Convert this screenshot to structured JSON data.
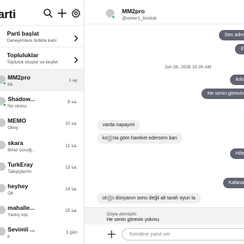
{
  "sidebar": {
    "title": "arti",
    "actions": [
      {
        "title": "Parti başlat",
        "subtitle": "Deneyimlere birlikte katıl"
      },
      {
        "title": "Topluluklar",
        "subtitle": "Topluluk oluştur ve keşfet"
      }
    ],
    "conversations": [
      {
        "name": "MM2pro",
        "last": "bb",
        "time": "1 ay",
        "online": true,
        "active": true
      },
      {
        "name": "Shadow...",
        "last": "No stress",
        "time": "9 sa.",
        "online": true,
        "active": false
      },
      {
        "name": "MEMO",
        "last": "Okey",
        "time": "10 sa.",
        "online": false,
        "active": false
      },
      {
        "name": "skara",
        "last": "Biraz çocuğ...",
        "time": "11 sa.",
        "online": false,
        "active": false
      },
      {
        "name": "TurkEray",
        "last": "Takipçilerim",
        "time": "13 sa.",
        "online": false,
        "active": false
      },
      {
        "name": "heyhey",
        "last": "Ok",
        "time": "14 sa.",
        "online": false,
        "active": false
      },
      {
        "name": "mahalle...",
        "last": "Yanlış kişi",
        "time": "15 sa.",
        "online": false,
        "active": false
      },
      {
        "name": "Sevimli ...",
        "last": "k",
        "time": "1 gün",
        "online": false,
        "active": false
      }
    ]
  },
  "chat": {
    "contact_name": "MM2pro",
    "contact_handle": "@omer1_bosluk",
    "date_separator": "Jun 28, 2026 10:26 AM",
    "messages": [
      {
        "dir": "out",
        "text": "Sen adm"
      },
      {
        "dir": "out",
        "text": "E"
      },
      {
        "dir": "out",
        "text": "Arkı"
      },
      {
        "dir": "out",
        "text": "He senin görevin"
      },
      {
        "dir": "in",
        "text": "varda napayım"
      },
      {
        "dir": "in",
        "text": "katama göre hareket edersem ban"
      },
      {
        "dir": "out",
        "text": "Hile"
      },
      {
        "dir": "out",
        "text": "Kafana"
      },
      {
        "dir": "in",
        "text": "olsun dünyanın sonu değil alt tarafı oyun la"
      }
    ],
    "reply_label": "Şöyle demiştin:",
    "reply_text": "He senin görevin yokmu",
    "composer_placeholder": "Kendine yanıt ver"
  },
  "colors": {
    "outgoing_bubble": "#5f6372",
    "incoming_bubble": "#efeff2",
    "online": "#2fb34a"
  },
  "icons": [
    "search-icon",
    "plus-icon",
    "gear-icon",
    "chevron-right-icon",
    "add-attachment-icon"
  ]
}
